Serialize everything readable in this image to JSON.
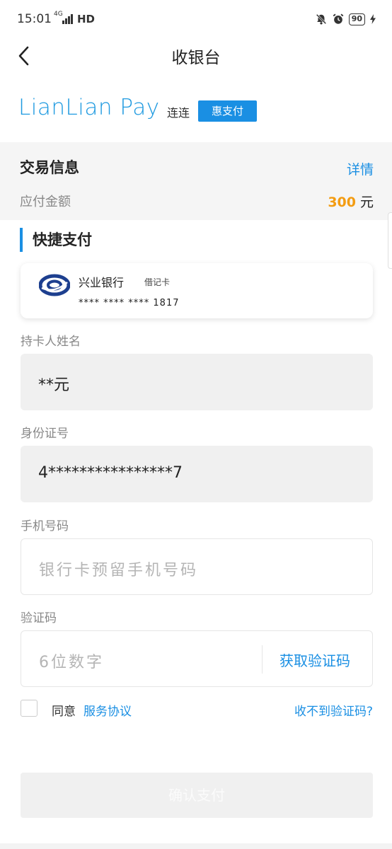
{
  "status_bar": {
    "time": "15:01",
    "network": "4G",
    "hd": "HD",
    "battery": "90",
    "icons": [
      "mute-bell-icon",
      "alarm-icon",
      "battery-icon",
      "charging-icon"
    ]
  },
  "nav": {
    "title": "收银台",
    "back_icon": "chevron-left-icon"
  },
  "brand": {
    "logo_text": "LianLian Pay",
    "sub_text": "连连",
    "badge": "惠支付",
    "color": "#1a8fe3"
  },
  "transaction": {
    "title": "交易信息",
    "detail_link": "详情",
    "amount_label": "应付金额",
    "amount_value": "300",
    "amount_unit": "元",
    "amount_color": "#f39c12"
  },
  "section": {
    "title": "快捷支付"
  },
  "card": {
    "bank_name": "兴业银行",
    "card_type": "借记卡",
    "card_number": "**** **** **** 1817",
    "logo_icon": "cib-bank-logo-icon"
  },
  "form": {
    "cardholder": {
      "label": "持卡人姓名",
      "value": "**元"
    },
    "id_number": {
      "label": "身份证号",
      "value": "4****************7"
    },
    "phone": {
      "label": "手机号码",
      "placeholder": "银行卡预留手机号码"
    },
    "code": {
      "label": "验证码",
      "placeholder": "6位数字",
      "get_code": "获取验证码"
    }
  },
  "agreement": {
    "agree_text": "同意",
    "agreement_link": "服务协议",
    "no_code_link": "收不到验证码?"
  },
  "submit": {
    "label": "确认支付"
  }
}
